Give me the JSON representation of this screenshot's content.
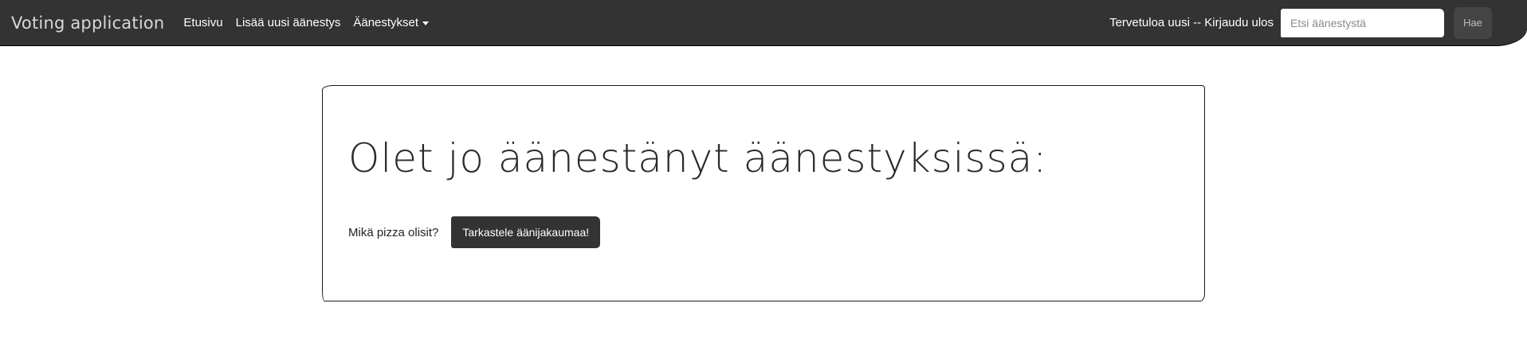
{
  "navbar": {
    "brand": "Voting application",
    "links": {
      "home": "Etusivu",
      "add_poll": "Lisää uusi äänestys",
      "polls": "Äänestykset"
    },
    "welcome": "Tervetuloa uusi -- Kirjaudu ulos",
    "search": {
      "placeholder": "Etsi äänestystä",
      "value": "",
      "button_label": "Hae"
    }
  },
  "main": {
    "title": "Olet jo äänestänyt äänestyksissä:",
    "voted_polls": [
      {
        "name": "Mikä pizza olisit?",
        "button_label": "Tarkastele äänijakaumaa!"
      }
    ]
  },
  "colors": {
    "navbar_bg": "#333333",
    "button_bg": "#333333",
    "page_bg": "#ffffff"
  }
}
